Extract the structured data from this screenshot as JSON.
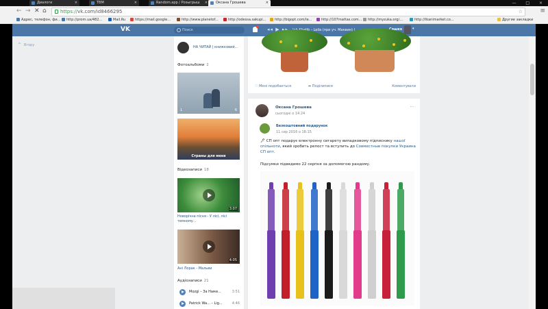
{
  "browser": {
    "tabs": [
      {
        "label": "Диалоги",
        "favicon_color": "#5181b8"
      },
      {
        "label": "TBM",
        "favicon_color": "#5181b8"
      },
      {
        "label": "Random.app / Розыгрыш",
        "favicon_color": "#5181b8"
      },
      {
        "label": "Оксана Грошева",
        "favicon_color": "#5181b8",
        "active": true
      }
    ],
    "url_scheme": "https://",
    "url_rest": "vk.com/id8466295",
    "bookmarks": [
      {
        "label": "Адрес, телефон, фи...",
        "color": "#4a76a8"
      },
      {
        "label": "http://prom.ua/482...",
        "color": "#4a76a8"
      },
      {
        "label": "Mail.Ru",
        "color": "#1f5fb8"
      },
      {
        "label": "https://mail.google...",
        "color": "#d44638"
      },
      {
        "label": "http://www.planetof...",
        "color": "#7a4d2e"
      },
      {
        "label": "http://odessa.sakupi...",
        "color": "#c1272d"
      },
      {
        "label": "http://bigopt.com/le...",
        "color": "#e9a21b"
      },
      {
        "label": "http://107mattas.com...",
        "color": "#8e44ad"
      },
      {
        "label": "http://myzuka.org/...",
        "color": "#999999"
      },
      {
        "label": "http://tkanimarket.co...",
        "color": "#2c9ab7"
      },
      {
        "label": "Другие закладки",
        "color": "#e8c04a"
      }
    ]
  },
  "vk": {
    "logo": "VK",
    "search_placeholder": "Поиск",
    "player_controls": "◂◂ ▶ ▸▸",
    "now_playing": "Jah Khalib – Leila (при уч. Маквин) (...",
    "user_name": "Сашко",
    "up_label": "Вгору",
    "accent": "#4a76a8"
  },
  "left": {
    "game_label": "НА ЧИТАЙ | книжковий...",
    "albums_title": "Фотоальбоми",
    "albums_count": "2",
    "album1_count_left": "1",
    "album1_count_right": "6",
    "album2_caption": "Страны для меня",
    "videos_title": "Відеозаписи",
    "videos_count": "18",
    "video1_duration": "3:07",
    "video1_title": "Новорічна пісня - У лісі, лісі темному...",
    "video2_duration": "4:05",
    "video2_title": "Ані Лорак - Мальви",
    "audio_title": "Аудіозаписи",
    "audio_count": "21",
    "tracks": [
      {
        "title": "Mozgi – За Нами...",
        "duration": "3:51"
      },
      {
        "title": "Patrick Wa... – Lig...",
        "duration": "4:46"
      }
    ]
  },
  "postA": {
    "likes": "Мені подобається",
    "share": "Поділитися",
    "comments": "Коментувати"
  },
  "postB": {
    "author": "Оксана Грошева",
    "time": "сьогодні о 14:24",
    "group_name": "Безкоштовний подарунок",
    "group_date": "11 сер 2016 о 18:15",
    "text_lead": "🖊 СП опт подарує електронну сигарету випадковому підписнику ",
    "link1": "нашої спільноти",
    "text_mid": ", який зробить репост та вступить до ",
    "link2": "Совместные покупки Украина СП опт",
    "text_end": ".",
    "text2": "Підсумки підведемо 22 серпня за допомогою рандому."
  },
  "ecig_colors": [
    "#6f3fb0",
    "#c31f2a",
    "#e8c21a",
    "#1f63c6",
    "#1b1b1b",
    "#d9d9d9",
    "#e23b8b",
    "#cfcfcf",
    "#c81f3a",
    "#2d9b4b"
  ]
}
